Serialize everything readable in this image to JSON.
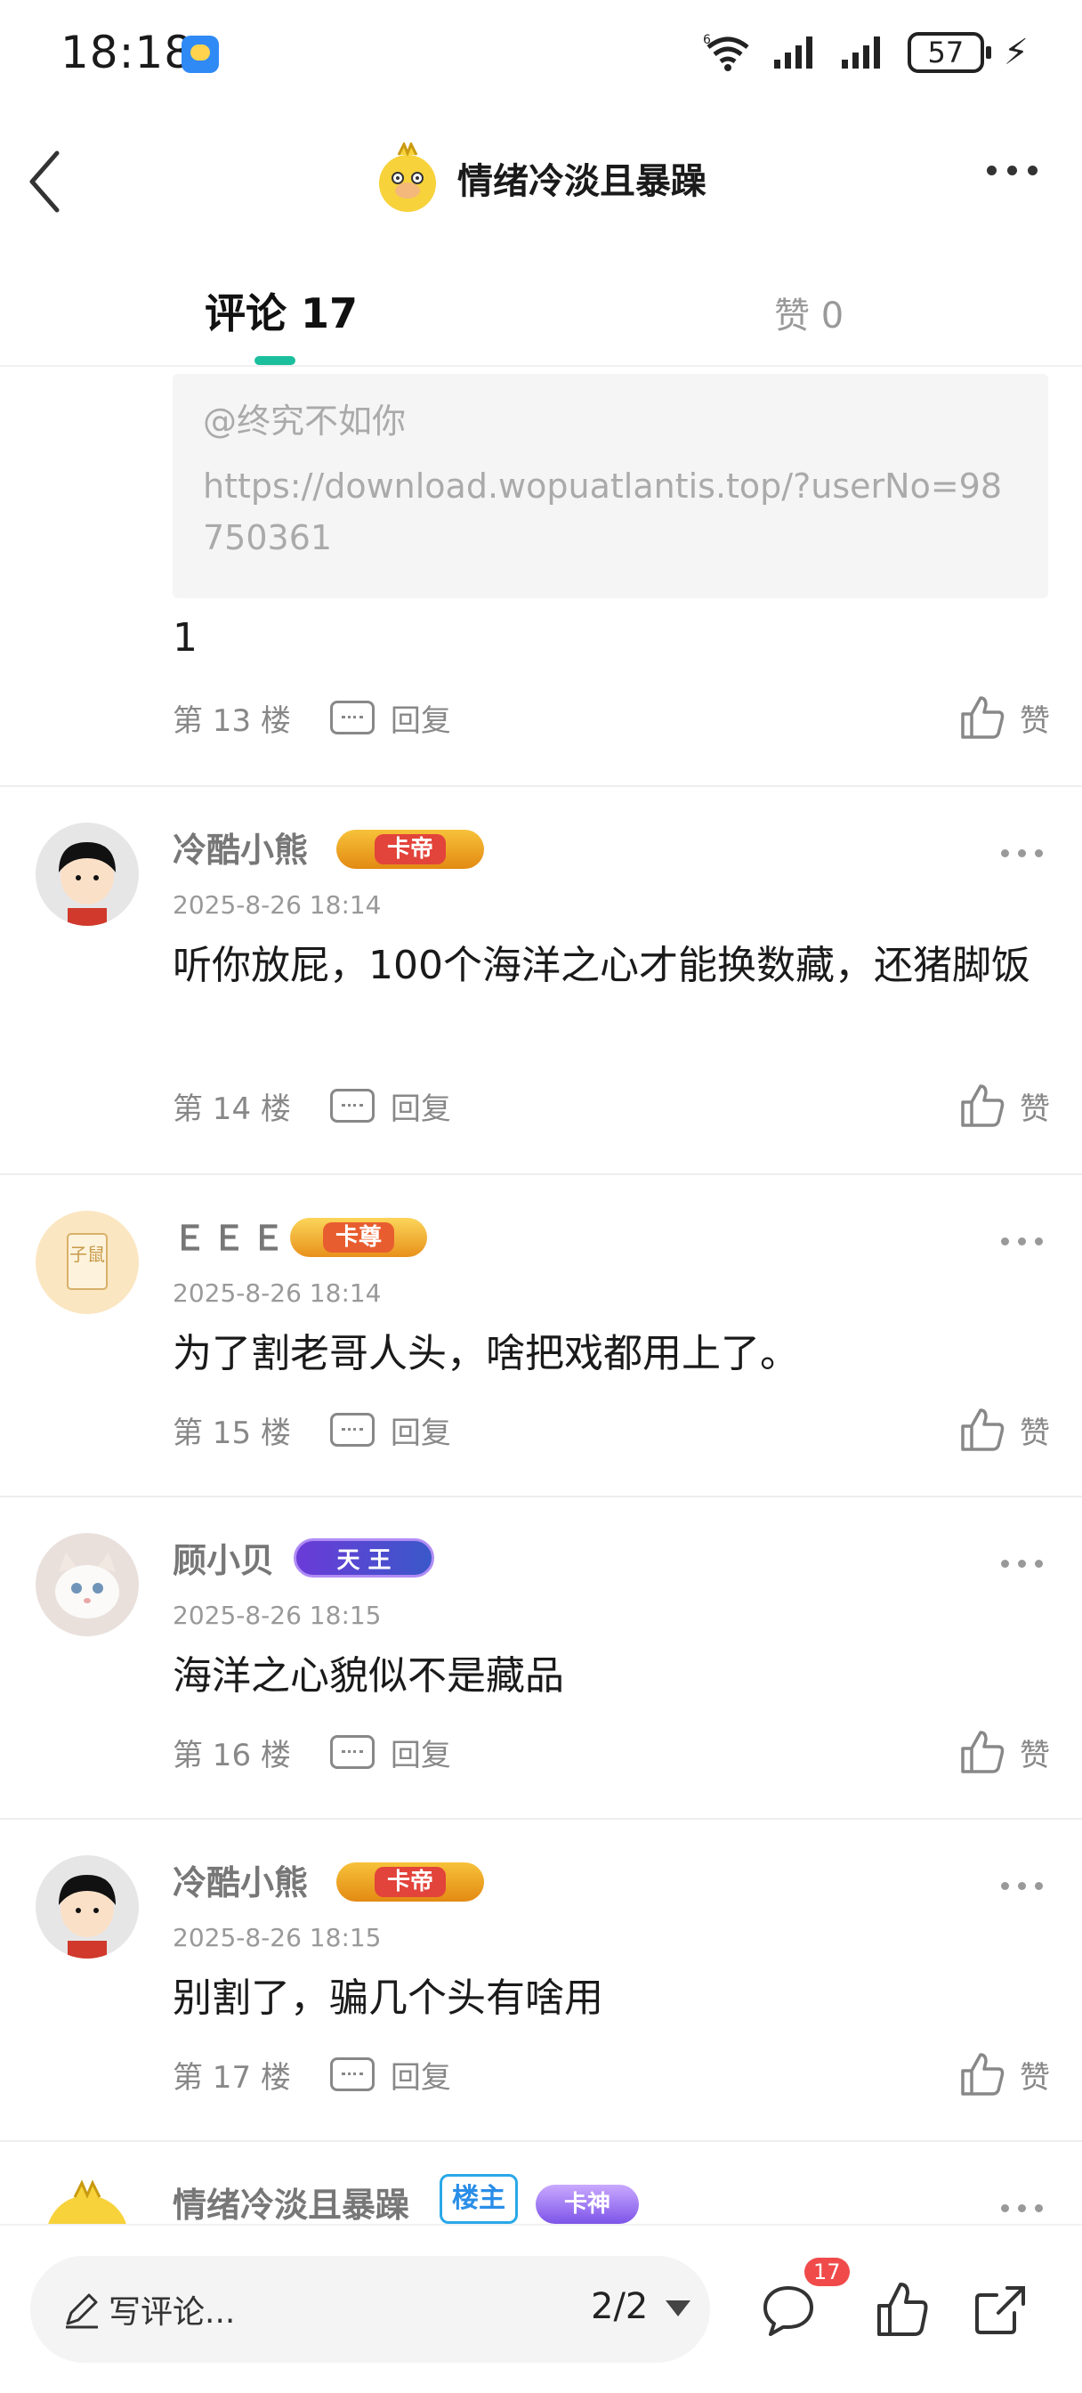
{
  "status": {
    "time": "18:18",
    "battery": "57",
    "signal_label": "6"
  },
  "nav": {
    "title": "情绪冷淡且暴躁"
  },
  "tabs": {
    "comments_label": "评论 17",
    "likes_label": "赞 0"
  },
  "quoted": {
    "user": "@终究不如你",
    "link": "https://download.wopuatlantis.top/?userNo=98750361"
  },
  "comments": [
    {
      "text": "1",
      "floor": "第 13 楼",
      "reply": "回复",
      "like": "赞"
    },
    {
      "user": "冷酷小熊",
      "badge": "卡帝",
      "time": "2025-8-26 18:14",
      "text": "听你放屁，100个海洋之心才能换数藏，还猪脚饭",
      "floor": "第 14 楼",
      "reply": "回复",
      "like": "赞"
    },
    {
      "user": "ＥＥＥ",
      "badge": "卡尊",
      "avatar_text": "子鼠",
      "time": "2025-8-26 18:14",
      "text": "为了割老哥人头，啥把戏都用上了。",
      "floor": "第 15 楼",
      "reply": "回复",
      "like": "赞"
    },
    {
      "user": "顾小贝",
      "badge": "天 王",
      "time": "2025-8-26 18:15",
      "text": "海洋之心貌似不是藏品",
      "floor": "第 16 楼",
      "reply": "回复",
      "like": "赞"
    },
    {
      "user": "冷酷小熊",
      "badge": "卡帝",
      "time": "2025-8-26 18:15",
      "text": "别割了，骗几个头有啥用",
      "floor": "第 17 楼",
      "reply": "回复",
      "like": "赞"
    },
    {
      "user": "情绪冷淡且暴躁",
      "badge_owner": "楼主",
      "badge": "卡神"
    }
  ],
  "bottom": {
    "placeholder": "写评论...",
    "pager": "2/2",
    "comment_count": "17"
  },
  "colors": {
    "accent": "#1cbf9d",
    "badge_red": "#f04a4a"
  },
  "icons": [
    "back-icon",
    "more-icon",
    "reply-icon",
    "thumb-up-icon",
    "pen-icon",
    "comment-icon",
    "share-icon",
    "wifi-icon",
    "signal-icon",
    "battery-icon",
    "charging-icon"
  ]
}
